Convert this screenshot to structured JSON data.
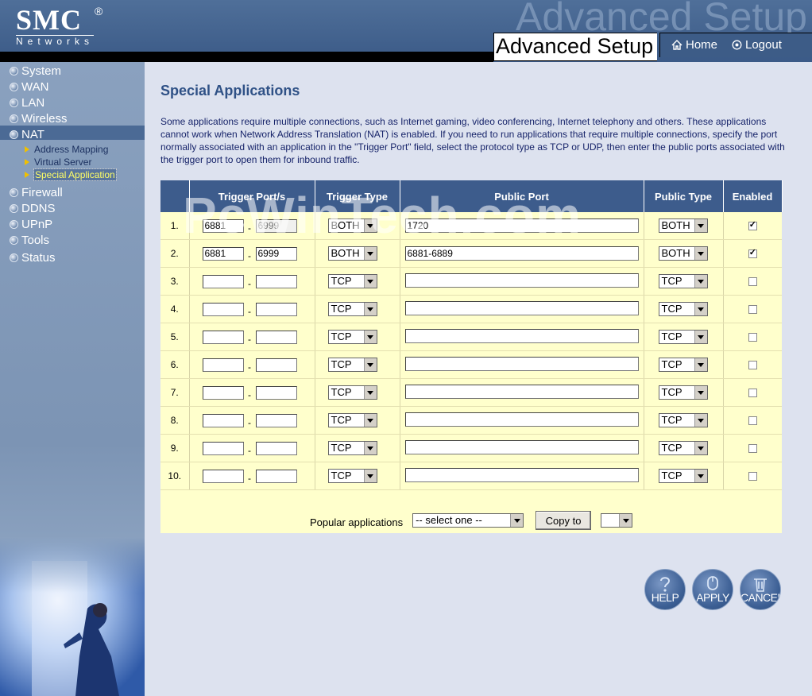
{
  "header": {
    "logo_brand": "SMC",
    "logo_reg": "®",
    "logo_sub": "Networks",
    "watermark": "Advanced Setup",
    "title": "Advanced Setup",
    "home": "Home",
    "logout": "Logout"
  },
  "sidebar": {
    "items": [
      {
        "label": "System"
      },
      {
        "label": "WAN"
      },
      {
        "label": "LAN"
      },
      {
        "label": "Wireless"
      },
      {
        "label": "NAT"
      },
      {
        "label": "Firewall"
      },
      {
        "label": "DDNS"
      },
      {
        "label": "UPnP"
      },
      {
        "label": "Tools"
      },
      {
        "label": "Status"
      }
    ],
    "nat_sub": [
      {
        "label": "Address Mapping"
      },
      {
        "label": "Virtual Server"
      },
      {
        "label": "Special Application"
      }
    ]
  },
  "content": {
    "title": "Special Applications",
    "description": "Some applications require multiple connections, such as Internet gaming, video conferencing, Internet telephony and others. These applications cannot work when Network Address Translation (NAT) is enabled. If you need to run applications that require multiple connections, specify the port normally associated with an application in the \"Trigger Port\" field, select the protocol type as TCP or UDP, then enter the public ports associated with the trigger port to open them for inbound traffic.",
    "watermark": "PcWinTech.com"
  },
  "table": {
    "headers": {
      "num": "",
      "trigger_ports": "Trigger Port/s",
      "trigger_type": "Trigger Type",
      "public_port": "Public Port",
      "public_type": "Public Type",
      "enabled": "Enabled"
    },
    "rows": [
      {
        "num": "1.",
        "from": "6881",
        "to": "6999",
        "ttype": "BOTH",
        "public": "1720",
        "ptype": "BOTH",
        "enabled": true
      },
      {
        "num": "2.",
        "from": "6881",
        "to": "6999",
        "ttype": "BOTH",
        "public": "6881-6889",
        "ptype": "BOTH",
        "enabled": true
      },
      {
        "num": "3.",
        "from": "",
        "to": "",
        "ttype": "TCP",
        "public": "",
        "ptype": "TCP",
        "enabled": false
      },
      {
        "num": "4.",
        "from": "",
        "to": "",
        "ttype": "TCP",
        "public": "",
        "ptype": "TCP",
        "enabled": false
      },
      {
        "num": "5.",
        "from": "",
        "to": "",
        "ttype": "TCP",
        "public": "",
        "ptype": "TCP",
        "enabled": false
      },
      {
        "num": "6.",
        "from": "",
        "to": "",
        "ttype": "TCP",
        "public": "",
        "ptype": "TCP",
        "enabled": false
      },
      {
        "num": "7.",
        "from": "",
        "to": "",
        "ttype": "TCP",
        "public": "",
        "ptype": "TCP",
        "enabled": false
      },
      {
        "num": "8.",
        "from": "",
        "to": "",
        "ttype": "TCP",
        "public": "",
        "ptype": "TCP",
        "enabled": false
      },
      {
        "num": "9.",
        "from": "",
        "to": "",
        "ttype": "TCP",
        "public": "",
        "ptype": "TCP",
        "enabled": false
      },
      {
        "num": "10.",
        "from": "",
        "to": "",
        "ttype": "TCP",
        "public": "",
        "ptype": "TCP",
        "enabled": false
      }
    ]
  },
  "popular": {
    "label": "Popular applications",
    "select_value": "-- select one --",
    "copy_label": "Copy to",
    "target_value": ""
  },
  "buttons": {
    "help": "HELP",
    "apply": "APPLY",
    "cancel": "CANCEL"
  },
  "colors": {
    "header_bg": "#3b5a87",
    "table_header_bg": "#3d5c8c",
    "table_body_bg": "#ffffcc",
    "title_color": "#2f5186",
    "active_submenu": "#ffff66"
  }
}
